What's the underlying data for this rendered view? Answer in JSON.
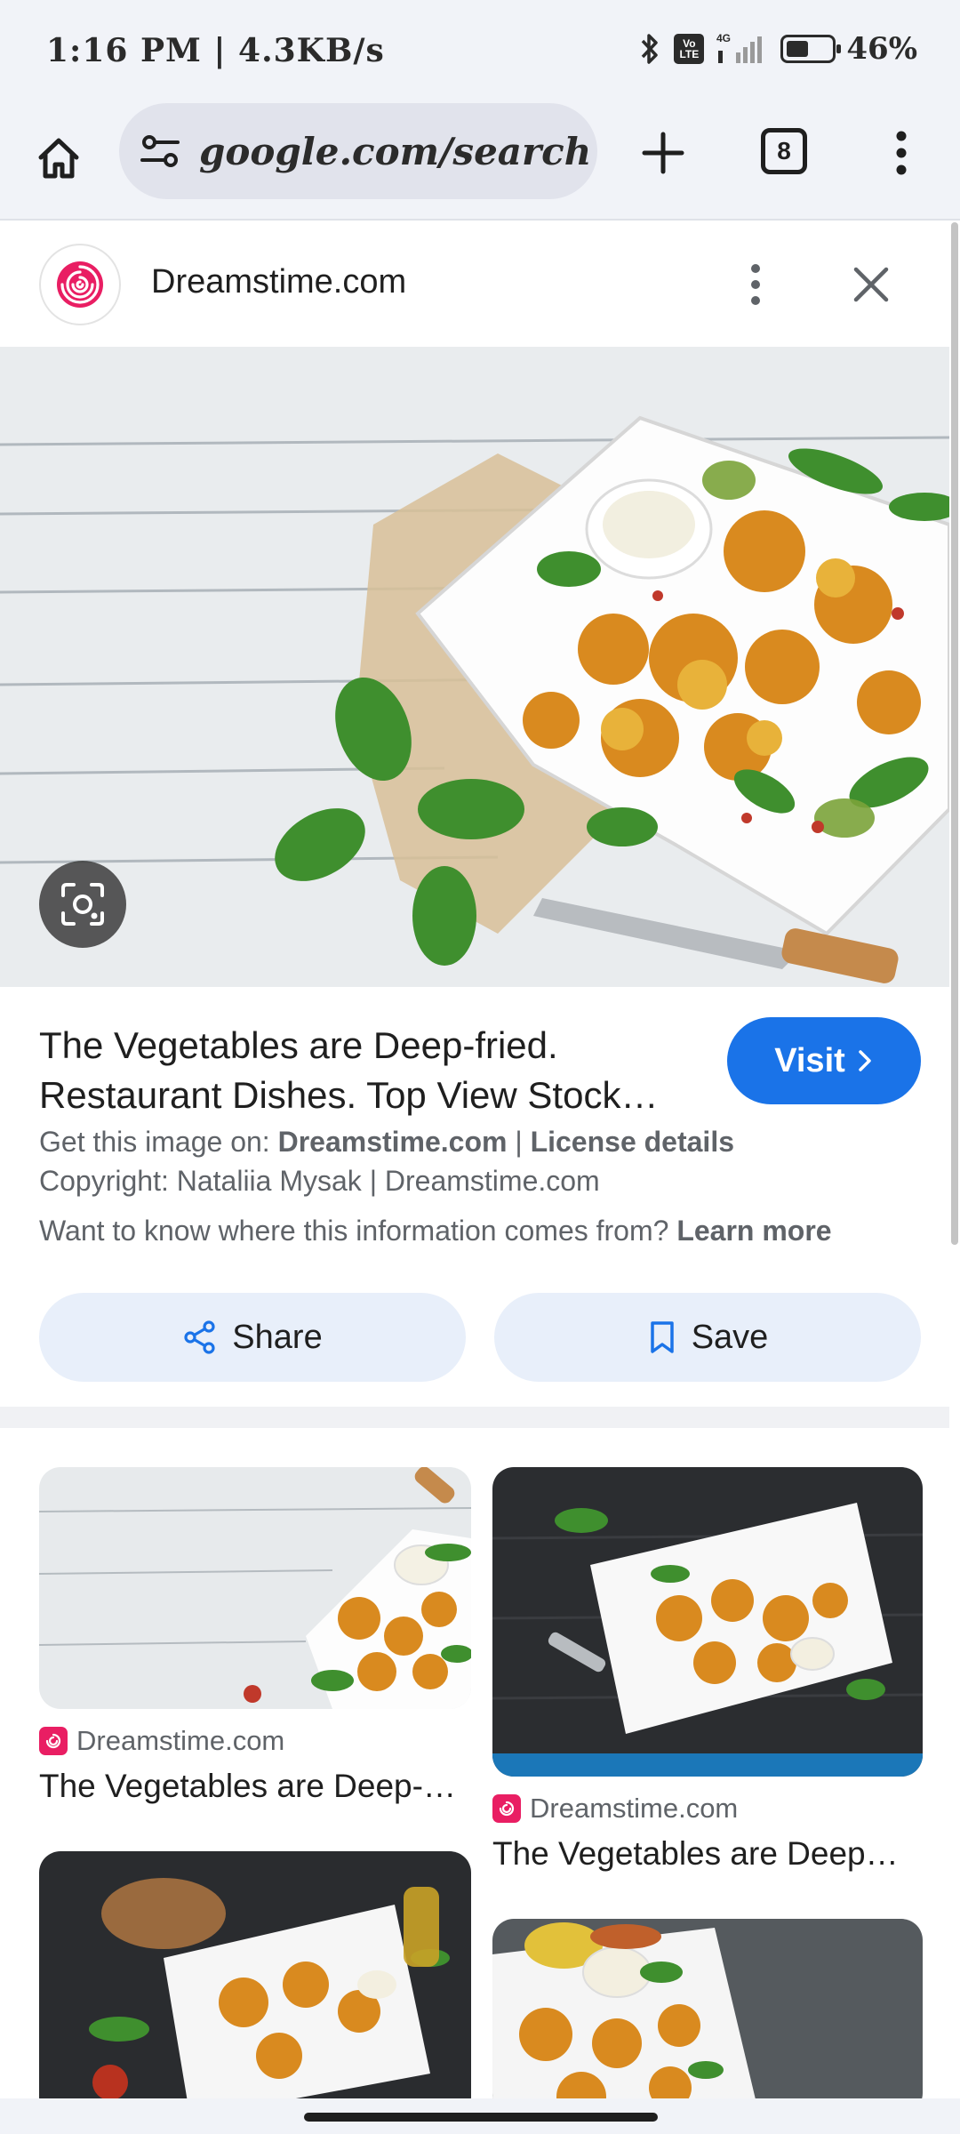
{
  "status_bar": {
    "time": "1:16 PM | 4.3KB/s",
    "network": "4G",
    "volte": "Vo LTE",
    "battery": "46%"
  },
  "toolbar": {
    "url": "google.com/search",
    "tab_count": "8"
  },
  "source": {
    "name": "Dreamstime.com"
  },
  "details": {
    "title_line1": "The Vegetables are Deep-fried.",
    "title_line2": "Restaurant Dishes. Top View Stock…",
    "visit_label": "Visit",
    "get_image_prefix": "Get this image on: ",
    "get_image_site": "Dreamstime.com",
    "separator": " | ",
    "license_label": "License details",
    "copyright": "Copyright: Nataliia Mysak | Dreamstime.com",
    "info_question": "Want to know where this information comes from? ",
    "learn_more": "Learn more",
    "share_label": "Share",
    "save_label": "Save"
  },
  "related": [
    {
      "source": "Dreamstime.com",
      "title": "The Vegetables are Deep-…"
    },
    {
      "source": "Dreamstime.com",
      "title": "The Vegetables are Deep…"
    }
  ],
  "colors": {
    "accent": "#1a73e8",
    "chrome_bg": "#f1f3f8",
    "action_bg": "#e8effa",
    "brand_pink": "#e91e63"
  },
  "icons": {
    "home": "home-icon",
    "tune": "tune-icon",
    "plus": "plus-icon",
    "more": "more-vert-icon",
    "close": "close-icon",
    "lens": "google-lens-icon",
    "share": "share-icon",
    "bookmark": "bookmark-icon",
    "chevron": "chevron-right-icon"
  }
}
